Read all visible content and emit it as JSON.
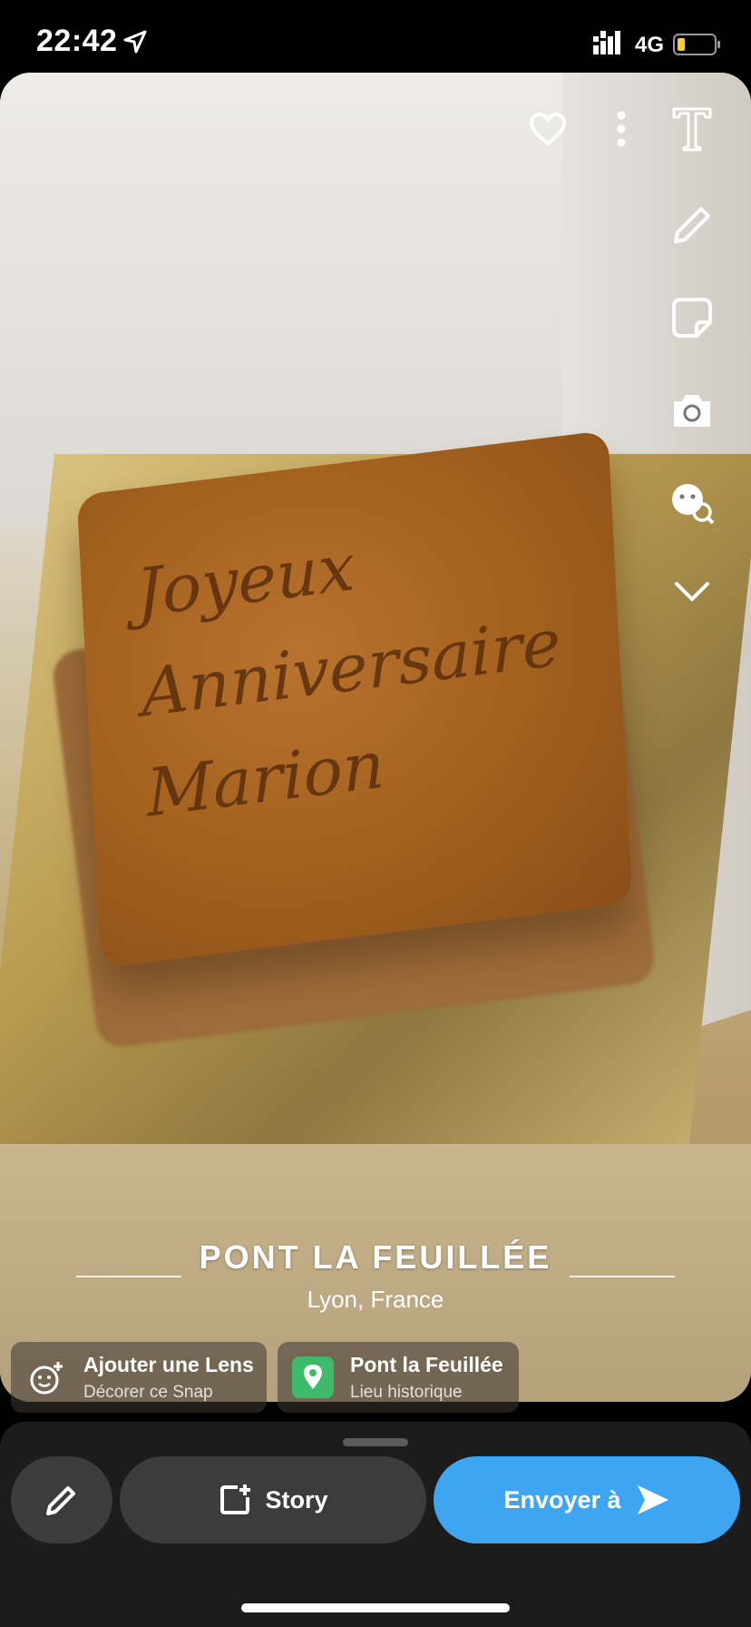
{
  "status_bar": {
    "time": "22:42",
    "network": "4G",
    "battery_color": "#f5d03a"
  },
  "photo": {
    "description_icons": [
      "heart-icon",
      "more-icon",
      "text-tool-icon",
      "draw-tool-icon",
      "sticker-tool-icon",
      "camera-lens-icon",
      "emoji-lens-icon",
      "chevron-down-icon"
    ],
    "cake_script": "Joyeux Anniversaire Marion"
  },
  "geofilter": {
    "title": "PONT LA FEUILLÉE",
    "subtitle": "Lyon, France"
  },
  "chips": {
    "lens": {
      "title": "Ajouter une Lens",
      "subtitle": "Décorer ce Snap"
    },
    "place": {
      "title": "Pont la Feuillée",
      "subtitle": "Lieu historique"
    }
  },
  "actions": {
    "story_label": "Story",
    "send_label": "Envoyer à"
  },
  "colors": {
    "send_button": "#3ea5f2",
    "place_icon": "#3dbb6b"
  }
}
